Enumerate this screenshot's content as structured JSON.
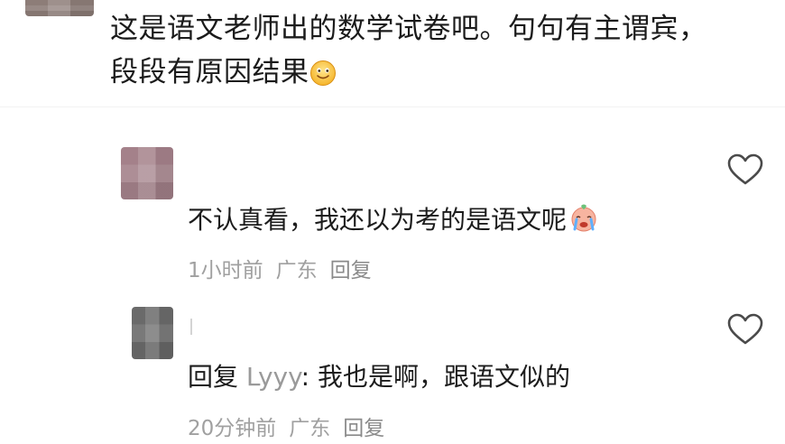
{
  "top_comment": {
    "text": "这是语文老师出的数学试卷吧。句句有主谓宾，段段有原因结果",
    "emoji": "smile-icon"
  },
  "replies": [
    {
      "text": "不认真看，我还以为考的是语文呢",
      "emoji": "crying-face-icon",
      "time": "1小时前",
      "location": "广东",
      "reply_label": "回复"
    },
    {
      "prefix": "回复",
      "target": "Lyyy",
      "separator": ": ",
      "text": "我也是啊，跟语文似的",
      "time": "20分钟前",
      "location": "广东",
      "reply_label": "回复"
    }
  ],
  "icons": {
    "like": "heart-icon"
  },
  "colors": {
    "meta_text": "#a0a0a0",
    "reply_target": "#9a9a9a"
  }
}
